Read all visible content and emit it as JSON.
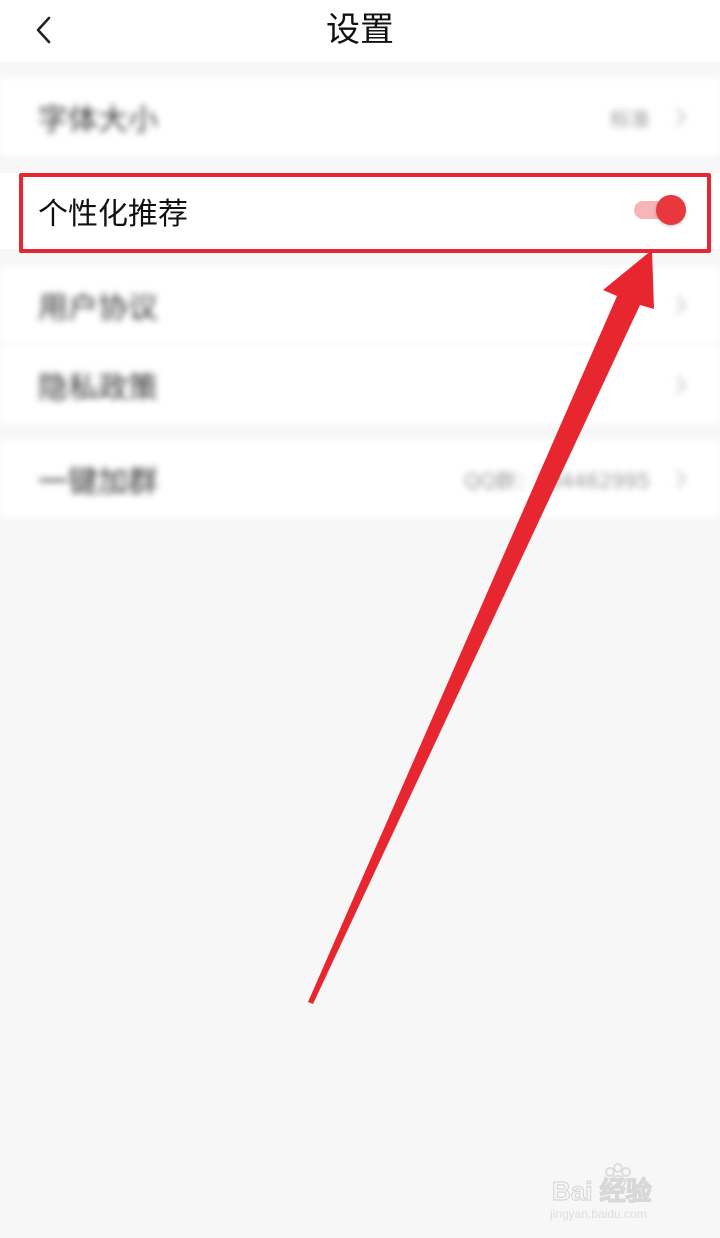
{
  "header": {
    "title": "设置",
    "back_icon": "chevron-left-icon"
  },
  "settings": {
    "font_size": {
      "label": "字体大小",
      "value": "标准"
    },
    "personalized": {
      "label": "个性化推荐",
      "enabled": true
    },
    "user_agreement": {
      "label": "用户协议"
    },
    "privacy_policy": {
      "label": "隐私政策"
    },
    "join_group": {
      "label": "一键加群",
      "value": "QQ群：784462995"
    }
  },
  "colors": {
    "accent": "#e8383d",
    "highlight_border": "#e8262f",
    "background": "#f7f7f7"
  },
  "watermark": {
    "text": "Bai经验",
    "sub": "jingyan.baidu.com"
  }
}
